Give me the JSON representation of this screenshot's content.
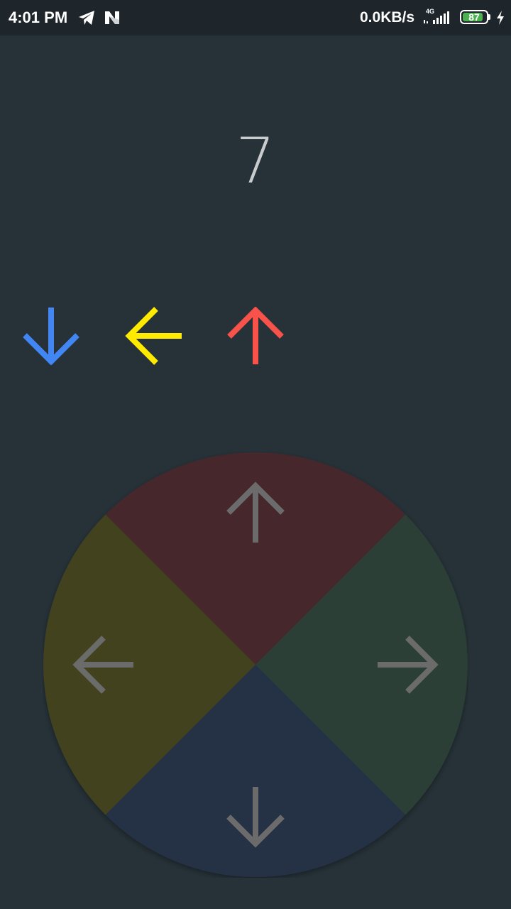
{
  "status_bar": {
    "time": "4:01 PM",
    "net_speed": "0.0KB/s",
    "network_type": "4G",
    "battery_percent": "87",
    "battery_level": 0.87,
    "icons": [
      "telegram-icon",
      "n-notification-icon",
      "signal-icon",
      "battery-icon",
      "charging-icon"
    ]
  },
  "game": {
    "score": "7",
    "sequence": [
      {
        "direction": "down",
        "color": "#4286f4"
      },
      {
        "direction": "left",
        "color": "#ffea00"
      },
      {
        "direction": "up",
        "color": "#f8524b"
      }
    ]
  },
  "control_wheel": {
    "segments": [
      {
        "direction": "up",
        "color": "#46282c"
      },
      {
        "direction": "right",
        "color": "#2c3f36"
      },
      {
        "direction": "down",
        "color": "#253145"
      },
      {
        "direction": "left",
        "color": "#43421f"
      }
    ],
    "arrow_color": "#6b6b6b"
  }
}
